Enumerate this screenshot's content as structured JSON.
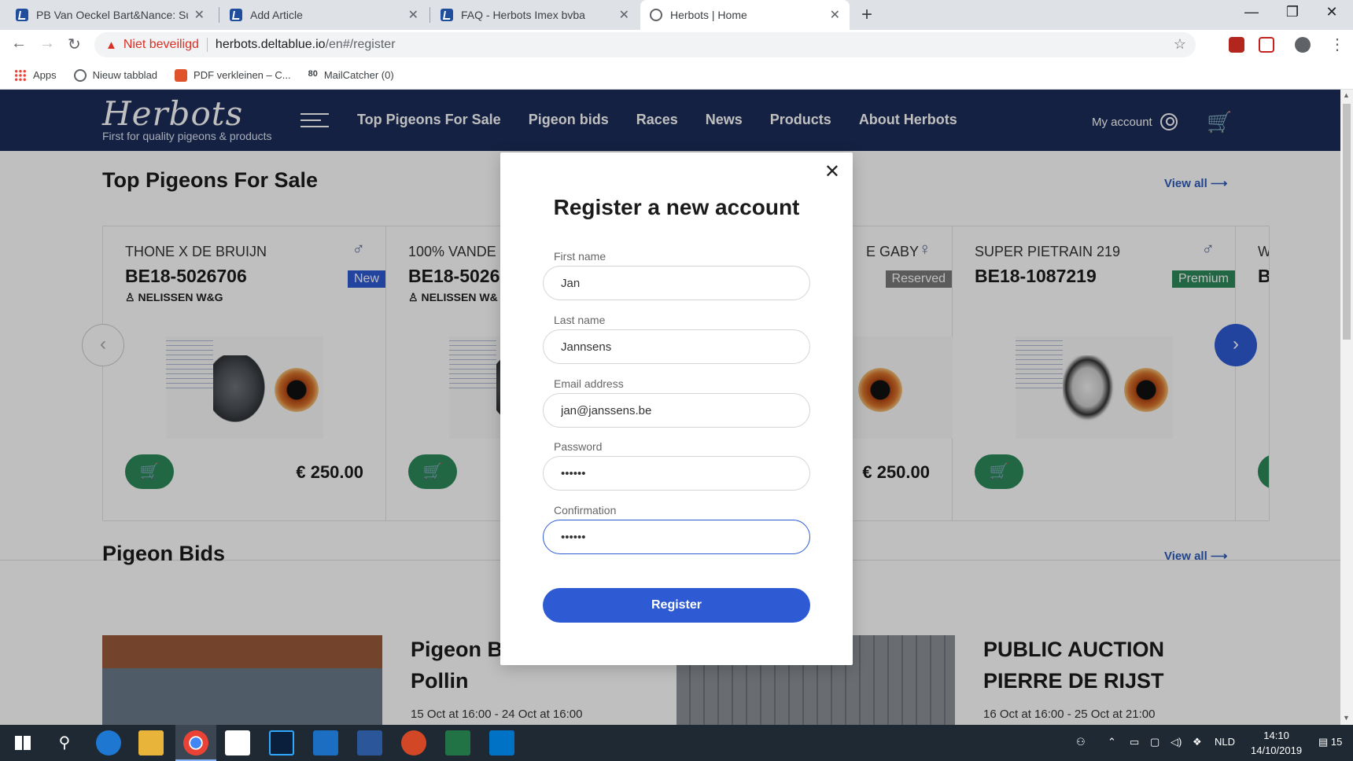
{
  "browser": {
    "tabs": [
      {
        "title": "PB Van Oeckel Bart&Nance: Sum",
        "active": false
      },
      {
        "title": "Add Article",
        "active": false
      },
      {
        "title": "FAQ - Herbots Imex bvba",
        "active": false
      },
      {
        "title": "Herbots | Home",
        "active": true
      }
    ],
    "security_label": "Niet beveiligd",
    "url_host": "herbots.deltablue.io",
    "url_path": "/en#/register",
    "bookmarks": [
      {
        "label": "Apps",
        "icon": "apps-icon"
      },
      {
        "label": "Nieuw tabblad",
        "icon": "globe-icon"
      },
      {
        "label": "PDF verkleinen – C...",
        "icon": "pdf-icon"
      },
      {
        "label": "MailCatcher (0)",
        "icon": "mailcatcher-icon",
        "prefix": "80"
      }
    ]
  },
  "site": {
    "logo": "Herbots",
    "tagline": "First for quality pigeons & products",
    "nav": [
      "Top Pigeons For Sale",
      "Pigeon bids",
      "Races",
      "News",
      "Products",
      "About Herbots"
    ],
    "my_account": "My account",
    "top_pigeons": {
      "title": "Top Pigeons For Sale",
      "view_all": "View all",
      "cards": [
        {
          "name": "THONE X DE BRUIJN",
          "ring": "BE18-5026706",
          "breeder": "NELISSEN W&G",
          "gender": "♂",
          "badge": "New",
          "badge_color": "#2e5bd4",
          "price": "€ 250.00"
        },
        {
          "name": "100% VANDE",
          "ring": "BE18-5026",
          "breeder": "NELISSEN W&",
          "gender": "",
          "badge": "",
          "badge_color": "",
          "price": ""
        },
        {
          "name": "E GABY",
          "ring": "",
          "breeder": "",
          "gender": "♀",
          "badge": "Reserved",
          "badge_color": "#7a7a7a",
          "price": "€ 250.00"
        },
        {
          "name": "SUPER PIETRAIN 219",
          "ring": "BE18-1087219",
          "breeder": "",
          "gender": "♂",
          "badge": "Premium",
          "badge_color": "#2e8a5b",
          "price": ""
        },
        {
          "name": "W",
          "ring": "B",
          "breeder": "",
          "gender": "",
          "badge": "",
          "badge_color": "",
          "price": ""
        }
      ]
    },
    "pigeon_bids": {
      "title": "Pigeon Bids",
      "view_all": "View all",
      "items": [
        {
          "title_line1": "Pigeon B",
          "title_line2": "Pollin",
          "date": "15 Oct at 16:00 - 24 Oct at 16:00"
        },
        {
          "title_line1": "PUBLIC AUCTION",
          "title_line2": "PIERRE DE RIJST",
          "date": "16 Oct at 16:00 - 25 Oct at 21:00"
        }
      ]
    }
  },
  "modal": {
    "title": "Register a new account",
    "fields": [
      {
        "label": "First name",
        "value": "Jan"
      },
      {
        "label": "Last name",
        "value": "Jannsens"
      },
      {
        "label": "Email address",
        "value": "jan@janssens.be"
      },
      {
        "label": "Password",
        "value": "••••••"
      },
      {
        "label": "Confirmation",
        "value": "••••••"
      }
    ],
    "submit_label": "Register"
  },
  "taskbar": {
    "language": "NLD",
    "time": "14:10",
    "date": "14/10/2019",
    "notifications": "15"
  }
}
